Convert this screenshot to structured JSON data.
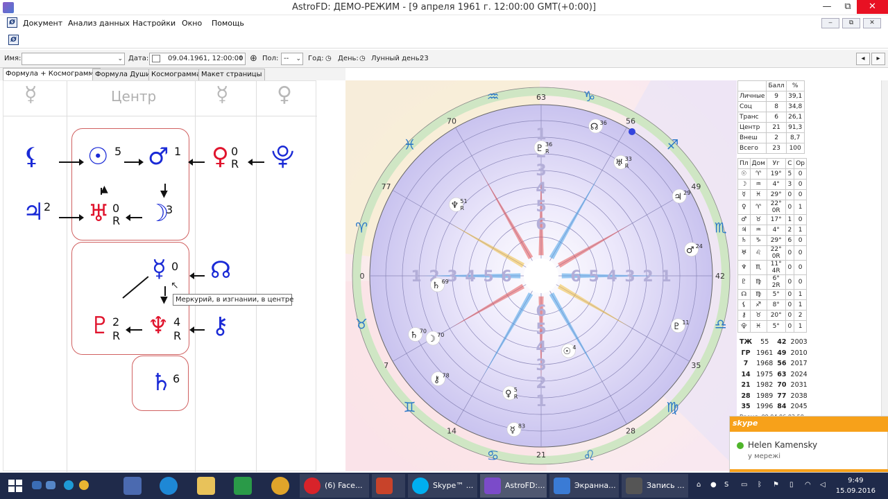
{
  "window": {
    "title": "AstroFD: ДЕМО-РЕЖИМ - [9 апреля 1961 г. 12:00:00 GMT(+0:00)]",
    "minimize": "—",
    "maximize": "⧉",
    "close": "✕"
  },
  "menu": [
    "Документ",
    "Анализ данных",
    "Настройки",
    "Окно",
    "Помощь"
  ],
  "mdi_buttons": [
    "‒",
    "⧉",
    "✕"
  ],
  "toolbar": {
    "name_label": "Имя:",
    "name_value": "",
    "date_label": "Дата:",
    "date_value": "09.04.1961, 12:00:00",
    "sex_label": "Пол:",
    "sex_value": "--",
    "year_label": "Год:",
    "day_label": "День:",
    "moon_day_label": "Лунный день:",
    "moon_day_value": "23",
    "nav_prev": "◂",
    "nav_next": "▸"
  },
  "tabs": [
    "Формула + Космограмма",
    "Формула Души",
    "Космограмма",
    "Макет страницы"
  ],
  "formula": {
    "header_glyphs": [
      "☿",
      "☿",
      "♀"
    ],
    "centre_label": "Центр",
    "tooltip": "Меркурий, в изгнании, в центре",
    "items": [
      {
        "glyph": "⚸",
        "num": "",
        "r": ""
      },
      {
        "glyph": "☉",
        "num": "5",
        "r": ""
      },
      {
        "glyph": "♂",
        "num": "1",
        "r": ""
      },
      {
        "glyph": "♀",
        "num": "0",
        "r": "R"
      },
      {
        "glyph": "⯓",
        "num": "",
        "r": ""
      },
      {
        "glyph": "♃",
        "num": "2",
        "r": ""
      },
      {
        "glyph": "♅",
        "num": "0",
        "r": "R"
      },
      {
        "glyph": "☽",
        "num": "3",
        "r": ""
      },
      {
        "glyph": "☿",
        "num": "0",
        "r": ""
      },
      {
        "glyph": "☊",
        "num": "",
        "r": ""
      },
      {
        "glyph": "♇",
        "num": "2",
        "r": "R"
      },
      {
        "glyph": "♆",
        "num": "4",
        "r": "R"
      },
      {
        "glyph": "⚷",
        "num": "",
        "r": ""
      },
      {
        "glyph": "♄",
        "num": "6",
        "r": ""
      }
    ]
  },
  "chart": {
    "outer_degrees": [
      "63",
      "56",
      "49",
      "42",
      "35",
      "28",
      "21",
      "14",
      "7",
      "0",
      "77",
      "70"
    ],
    "signs": [
      "♑",
      "♐",
      "♏",
      "♎",
      "♍",
      "♌",
      "♋",
      "♊",
      "♉",
      "♈",
      "♓",
      "♒"
    ],
    "house_numbers_top": [
      "1",
      "2",
      "3",
      "4",
      "5",
      "6"
    ],
    "house_numbers_left": [
      "6",
      "5",
      "4",
      "3",
      "2",
      "1"
    ],
    "house_numbers_right": [
      "6",
      "5",
      "4",
      "3",
      "2",
      "1"
    ],
    "house_numbers_bottom": [
      "6",
      "5",
      "4",
      "3",
      "2",
      "1"
    ],
    "planets": [
      {
        "glyph": "♄",
        "num": "70"
      },
      {
        "glyph": "☽",
        "num": "70"
      },
      {
        "glyph": "⚷",
        "num": "78"
      },
      {
        "glyph": "♄",
        "num": "69"
      },
      {
        "glyph": "♆",
        "num": "51",
        "r": "R"
      },
      {
        "glyph": "☿",
        "num": "83"
      },
      {
        "glyph": "☉",
        "num": "4"
      },
      {
        "glyph": "♀",
        "num": "5",
        "r": "R"
      },
      {
        "glyph": "♇",
        "num": "36",
        "r": "R"
      },
      {
        "glyph": "☊",
        "num": "36"
      },
      {
        "glyph": "♅",
        "num": "33",
        "r": "R"
      },
      {
        "glyph": "♇",
        "num": "11"
      },
      {
        "glyph": "♂",
        "num": "24"
      },
      {
        "glyph": "♃",
        "num": "29"
      }
    ]
  },
  "score_table": {
    "head": [
      "",
      "Балл",
      "%"
    ],
    "rows": [
      [
        "Личные",
        "9",
        "39,1"
      ],
      [
        "Соц",
        "8",
        "34,8"
      ],
      [
        "Транс",
        "6",
        "26,1"
      ],
      [
        "Центр",
        "21",
        "91,3"
      ],
      [
        "Внеш",
        "2",
        "8,7"
      ],
      [
        "Всего",
        "23",
        "100"
      ]
    ]
  },
  "planet_table": {
    "head": [
      "Пл",
      "Дом",
      "Уг",
      "С",
      "Ор"
    ],
    "rows": [
      [
        "☉",
        "♈",
        "19°",
        "5",
        "0"
      ],
      [
        "☽",
        "♒",
        "4°",
        "3",
        "0"
      ],
      [
        "☿",
        "♓",
        "29°",
        "0",
        "0"
      ],
      [
        "♀",
        "♈",
        "22° 0R",
        "0",
        "1"
      ],
      [
        "♂",
        "♉",
        "17°",
        "1",
        "0"
      ],
      [
        "♃",
        "♒",
        "4°",
        "2",
        "1"
      ],
      [
        "♄",
        "♑",
        "29°",
        "6",
        "0"
      ],
      [
        "♅",
        "♌",
        "22° 0R",
        "0",
        "0"
      ],
      [
        "♆",
        "♏",
        "11° 4R",
        "0",
        "0"
      ],
      [
        "♇",
        "♍",
        "6° 2R",
        "0",
        "0"
      ],
      [
        "☊",
        "♍",
        "5°",
        "0",
        "1"
      ],
      [
        "⚸",
        "♐",
        "8°",
        "0",
        "1"
      ],
      [
        "⚷",
        "♉",
        "20°",
        "0",
        "2"
      ],
      [
        "⯓",
        "♓",
        "5°",
        "0",
        "1"
      ]
    ]
  },
  "years_table": {
    "rows": [
      [
        "ТЖ",
        "55",
        "42",
        "2003"
      ],
      [
        "ГР",
        "1961",
        "49",
        "2010"
      ],
      [
        "7",
        "1968",
        "56",
        "2017"
      ],
      [
        "14",
        "1975",
        "63",
        "2024"
      ],
      [
        "21",
        "1982",
        "70",
        "2031"
      ],
      [
        "28",
        "1989",
        "77",
        "2038"
      ],
      [
        "35",
        "1996",
        "84",
        "2045"
      ]
    ],
    "footer": "Время: 09.04.06:02:59"
  },
  "skype_toast": {
    "brand": "skype",
    "contact": "Helen Kamensky",
    "status": "у мережі"
  },
  "taskbar": {
    "tasks": [
      {
        "label": "(6) Face...",
        "color": "#d8232a"
      },
      {
        "label": "",
        "color": "#c8432a"
      },
      {
        "label": "Skype™ ...",
        "color": "#00aff0"
      },
      {
        "label": "AstroFD:...",
        "color": "#7b4bc9"
      },
      {
        "label": "Экранна...",
        "color": "#3a7bd5"
      },
      {
        "label": "Запись ...",
        "color": "#555"
      }
    ],
    "time": "9:49",
    "date": "15.09.2016"
  },
  "colors": {
    "planet_blue": "#1a2ad6",
    "planet_red": "#e0142d",
    "box_border": "#d06060",
    "taskbar": "#1f2a4a",
    "skype_orange": "#f7a11a"
  }
}
